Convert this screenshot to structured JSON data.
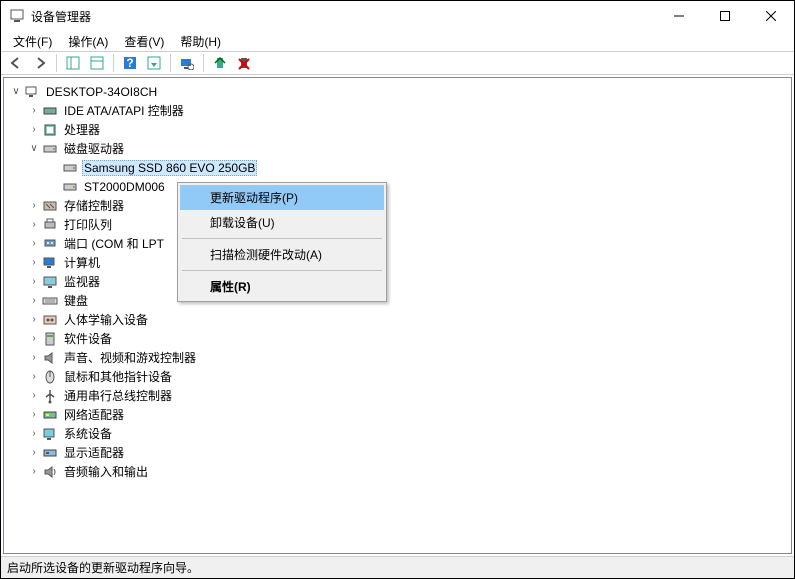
{
  "title": "设备管理器",
  "menubar": {
    "file": "文件(F)",
    "action": "操作(A)",
    "view": "查看(V)",
    "help": "帮助(H)"
  },
  "tree": {
    "root": "DESKTOP-34OI8CH",
    "ide": "IDE ATA/ATAPI 控制器",
    "cpu": "处理器",
    "disk": "磁盘驱动器",
    "disk_child0": "Samsung SSD 860 EVO 250GB",
    "disk_child1": "ST2000DM006",
    "storage_ctrl": "存储控制器",
    "print_queue": "打印队列",
    "ports": "端口 (COM 和 LPT",
    "computer": "计算机",
    "monitor": "监视器",
    "keyboard": "键盘",
    "hid": "人体学输入设备",
    "software_dev": "软件设备",
    "sound": "声音、视频和游戏控制器",
    "mouse": "鼠标和其他指针设备",
    "usb": "通用串行总线控制器",
    "network": "网络适配器",
    "system_dev": "系统设备",
    "display": "显示适配器",
    "audio_io": "音频输入和输出"
  },
  "context_menu": {
    "update_driver": "更新驱动程序(P)",
    "uninstall": "卸载设备(U)",
    "scan_hw": "扫描检测硬件改动(A)",
    "properties": "属性(R)"
  },
  "statusbar": "启动所选设备的更新驱动程序向导。"
}
